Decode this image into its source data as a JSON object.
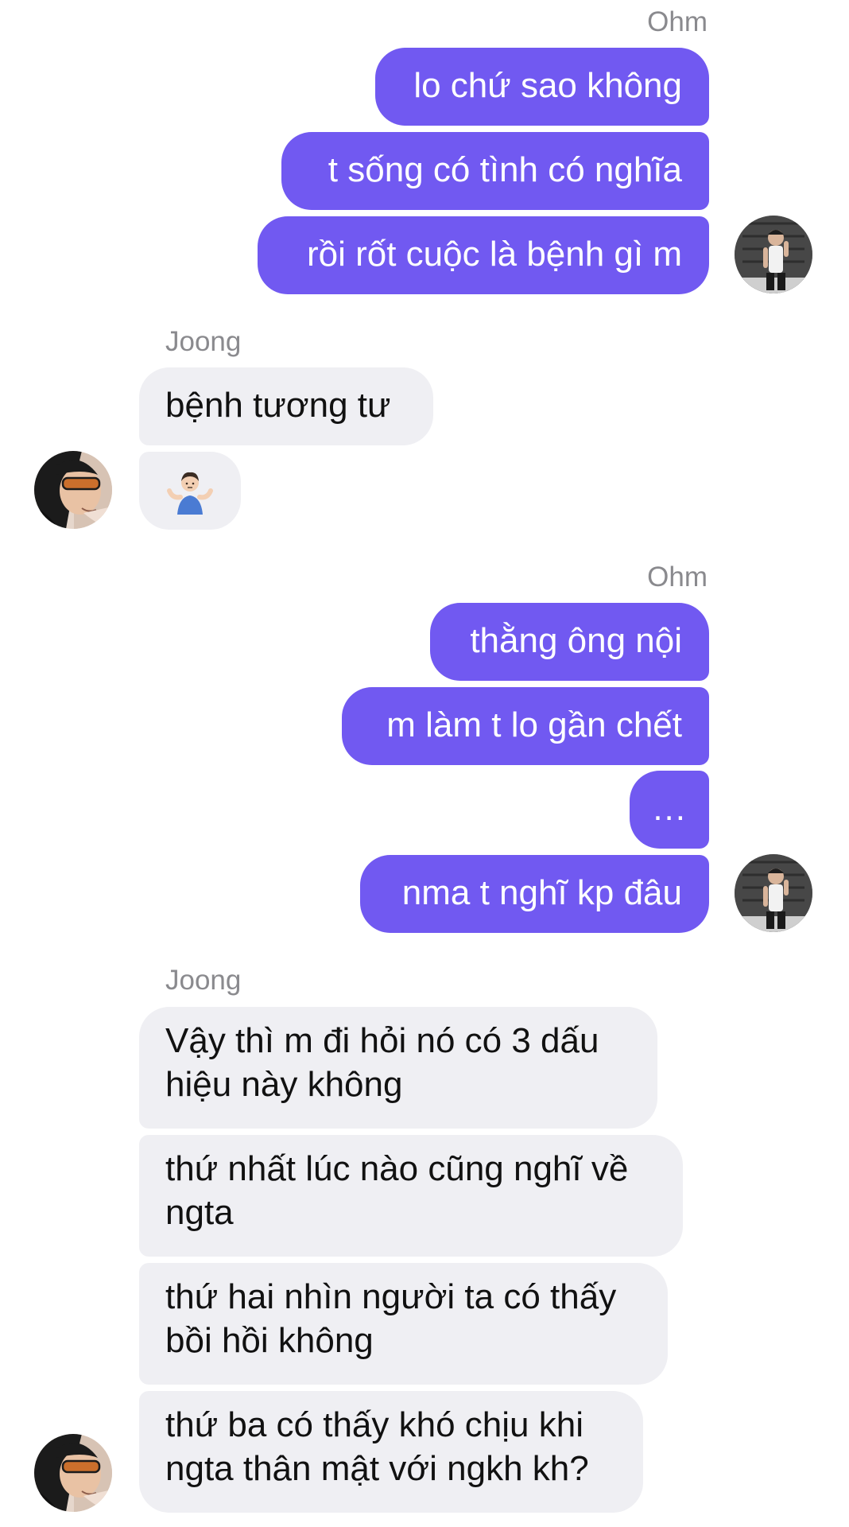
{
  "colors": {
    "outgoing_bubble": "#7159f1",
    "incoming_bubble": "#efeff3",
    "sender_name": "#8a8a8e"
  },
  "groups": [
    {
      "sender": "Ohm",
      "direction": "outgoing",
      "messages": [
        "lo chứ sao không",
        "t sống có tình có nghĩa",
        "rồi rốt cuộc là bệnh gì m"
      ]
    },
    {
      "sender": "Joong",
      "direction": "incoming",
      "messages": [
        "bệnh tương tư",
        "🤷🏻‍♂️"
      ]
    },
    {
      "sender": "Ohm",
      "direction": "outgoing",
      "messages": [
        "thằng ông nội",
        "m làm t lo gần chết",
        "...",
        "nma t nghĩ kp đâu"
      ]
    },
    {
      "sender": "Joong",
      "direction": "incoming",
      "messages": [
        "Vậy thì m đi hỏi nó có 3 dấu hiệu này không",
        "thứ nhất lúc nào cũng nghĩ về ngta",
        "thứ hai nhìn người ta có thấy bồi hồi không",
        "thứ ba có thấy khó chịu khi ngta thân mật với ngkh kh?"
      ]
    }
  ],
  "icons": {
    "shrug": "man-shrugging-emoji",
    "avatar_ohm": "avatar-photo",
    "avatar_joong": "avatar-photo"
  }
}
